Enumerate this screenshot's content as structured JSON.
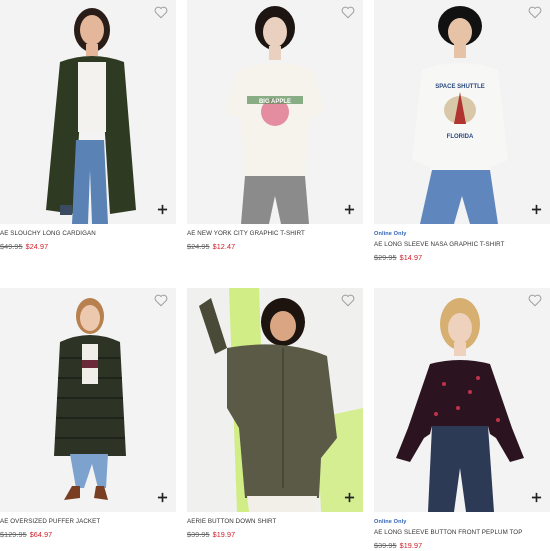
{
  "products": [
    {
      "name": "AE SLOUCHY LONG CARDIGAN",
      "online": "",
      "old_price": "$49.95",
      "new_price": "$24.97"
    },
    {
      "name": "AE NEW YORK CITY GRAPHIC T-SHIRT",
      "online": "",
      "old_price": "$24.95",
      "new_price": "$12.47",
      "tee_text": "BIG APPLE"
    },
    {
      "name": "AE LONG SLEEVE NASA GRAPHIC T-SHIRT",
      "online": "Online Only",
      "old_price": "$29.95",
      "new_price": "$14.97",
      "tee_text_top": "SPACE SHUTTLE",
      "tee_text_bottom": "FLORIDA"
    },
    {
      "name": "AE OVERSIZED PUFFER JACKET",
      "online": "",
      "old_price": "$129.95",
      "new_price": "$64.97"
    },
    {
      "name": "AERIE BUTTON DOWN SHIRT",
      "online": "",
      "old_price": "$39.95",
      "new_price": "$19.97"
    },
    {
      "name": "AE LONG SLEEVE BUTTON FRONT PEPLUM TOP",
      "online": "Online Only",
      "old_price": "$39.95",
      "new_price": "$19.97"
    }
  ],
  "colors": {
    "sale": "#d0202a",
    "online": "#2f63b5",
    "strike": "#666666"
  },
  "icons": {
    "favorite": "heart-outline-icon",
    "add": "plus-icon"
  }
}
